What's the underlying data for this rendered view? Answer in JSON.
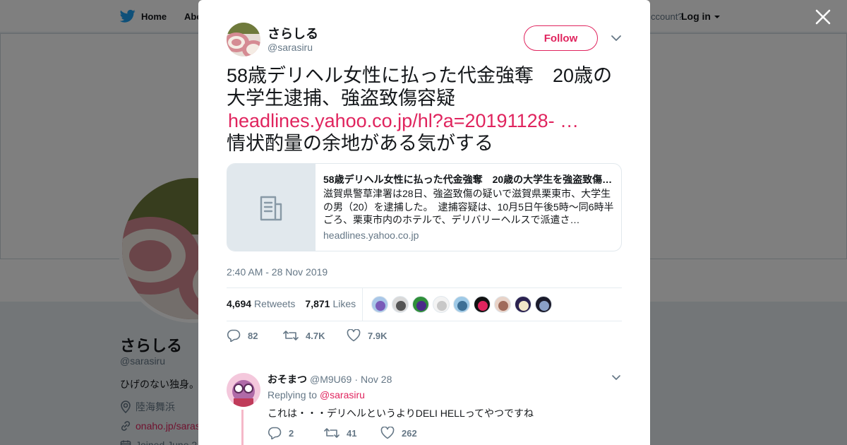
{
  "header": {
    "home_label": "Home",
    "about_label": "Abo",
    "account_prompt": "ccount?",
    "login_label": "Log in"
  },
  "profile": {
    "name": "さらしる",
    "handle": "@sarasiru",
    "bio": "ひげのない独身。",
    "location": "陸海舞浜",
    "website": "onaho.jp/saras",
    "joined": "Joined June 2"
  },
  "tweet": {
    "author_name": "さらしる",
    "author_handle": "@sarasiru",
    "follow_label": "Follow",
    "text_line1": "58歳デリヘル女性に払った代金強奪　20歳の大学生逮捕、強盗致傷容疑",
    "link": "headlines.yahoo.co.jp/hl?a=20191128- …",
    "text_line2": "情状酌量の余地がある気がする",
    "card": {
      "title": "58歳デリヘル女性に払った代金強奪　20歳の大学生を強盗致傷…",
      "description": "滋賀県警草津署は28日、強盗致傷の疑いで滋賀県栗東市、大学生の男（20）を逮捕した。　逮捕容疑は、10月5日午後5時～同6時半ごろ、栗東市内のホテルで、デリバリーヘルスで派遣さ…",
      "domain": "headlines.yahoo.co.jp"
    },
    "timestamp": "2:40 AM - 28 Nov 2019",
    "retweets_count": "4,694",
    "retweets_label": "Retweets",
    "likes_count": "7,871",
    "likes_label": "Likes",
    "likers": [
      {
        "name": "liker-1",
        "bg": "#a9c7e8",
        "fg": "#7a5bb8"
      },
      {
        "name": "liker-2",
        "bg": "#d9d9d9",
        "fg": "#555555"
      },
      {
        "name": "liker-3",
        "bg": "#2f8f3a",
        "fg": "#4a2a8a"
      },
      {
        "name": "liker-4",
        "bg": "#f3f3f3",
        "fg": "#c8c8c8"
      },
      {
        "name": "liker-5",
        "bg": "#9ec9e6",
        "fg": "#3d6f95"
      },
      {
        "name": "liker-6",
        "bg": "#111111",
        "fg": "#e0245e"
      },
      {
        "name": "liker-7",
        "bg": "#e8d3c8",
        "fg": "#a06a5a"
      },
      {
        "name": "liker-8",
        "bg": "#2b2250",
        "fg": "#f2e6c9"
      },
      {
        "name": "liker-9",
        "bg": "#1a1a2a",
        "fg": "#8aa0c8"
      }
    ],
    "reply_count": "82",
    "retweet_short": "4.7K",
    "like_short": "7.9K"
  },
  "reply": {
    "name": "おそまつ",
    "handle": "@M9U69",
    "separator": "·",
    "date": "Nov 28",
    "replying_prefix": "Replying to",
    "replying_to": "@sarasiru",
    "text": "これは・・・デリヘルというよりDELI HELLってやつですね",
    "reply_count": "2",
    "retweet_count": "41",
    "like_count": "262"
  },
  "colors": {
    "accent": "#e0245e",
    "twitter_blue": "#1da1f2",
    "muted": "#657786",
    "overlay": "rgba(0,0,0,0.5)"
  },
  "icons": [
    "twitter-bird-icon",
    "close-icon",
    "chevron-down-icon",
    "document-icon",
    "reply-icon",
    "retweet-icon",
    "heart-icon",
    "location-icon",
    "link-icon",
    "calendar-icon"
  ]
}
